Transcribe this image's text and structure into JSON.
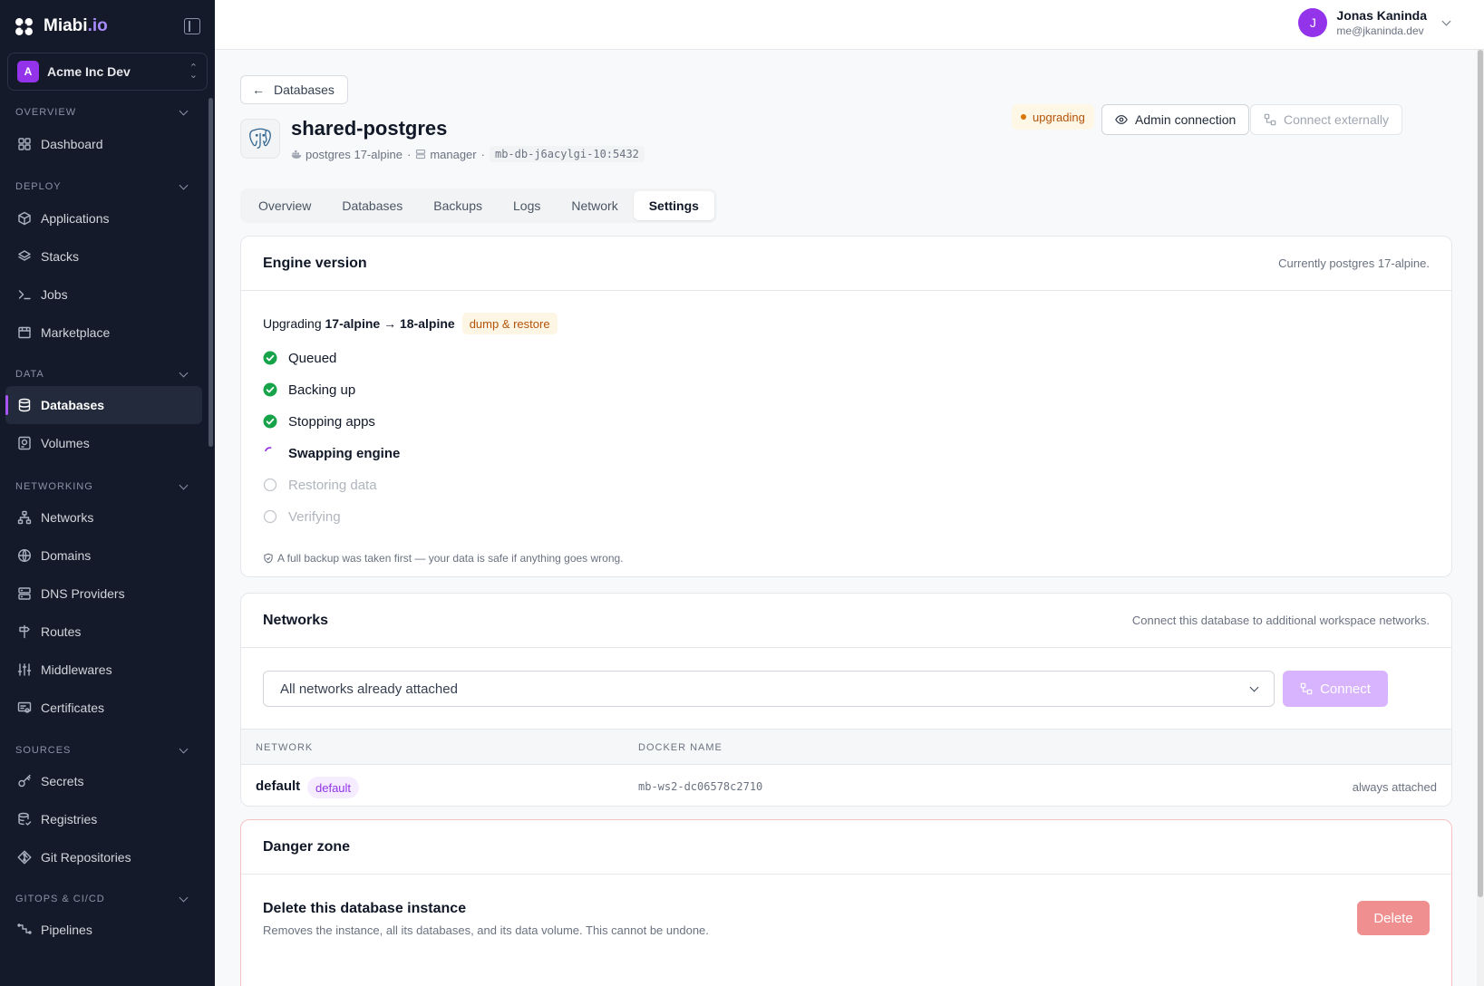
{
  "brand": {
    "name": "Miabi",
    "tld": ".io"
  },
  "workspace": {
    "initial": "A",
    "name": "Acme Inc Dev"
  },
  "sidebar": {
    "sections": [
      {
        "title": "OVERVIEW",
        "items": [
          {
            "label": "Dashboard",
            "icon": "dashboard-icon"
          }
        ]
      },
      {
        "title": "DEPLOY",
        "items": [
          {
            "label": "Applications",
            "icon": "cube-icon"
          },
          {
            "label": "Stacks",
            "icon": "layers-icon"
          },
          {
            "label": "Jobs",
            "icon": "terminal-icon"
          },
          {
            "label": "Marketplace",
            "icon": "store-icon"
          }
        ]
      },
      {
        "title": "DATA",
        "items": [
          {
            "label": "Databases",
            "icon": "database-icon",
            "active": true
          },
          {
            "label": "Volumes",
            "icon": "hard-drive-icon"
          }
        ]
      },
      {
        "title": "NETWORKING",
        "items": [
          {
            "label": "Networks",
            "icon": "network-icon"
          },
          {
            "label": "Domains",
            "icon": "globe-icon"
          },
          {
            "label": "DNS Providers",
            "icon": "server-icon"
          },
          {
            "label": "Routes",
            "icon": "signpost-icon"
          },
          {
            "label": "Middlewares",
            "icon": "sliders-icon"
          },
          {
            "label": "Certificates",
            "icon": "certificate-icon"
          }
        ]
      },
      {
        "title": "SOURCES",
        "items": [
          {
            "label": "Secrets",
            "icon": "key-icon"
          },
          {
            "label": "Registries",
            "icon": "registry-icon"
          },
          {
            "label": "Git Repositories",
            "icon": "git-icon"
          }
        ]
      },
      {
        "title": "GITOPS & CI/CD",
        "items": [
          {
            "label": "Pipelines",
            "icon": "pipeline-icon"
          }
        ]
      }
    ]
  },
  "user": {
    "initial": "J",
    "name": "Jonas Kaninda",
    "email": "me@jkaninda.dev"
  },
  "header": {
    "back_label": "Databases",
    "title": "shared-postgres",
    "engine": "postgres 17-alpine",
    "node": "manager",
    "host": "mb-db-j6acylgi-10:5432",
    "status": "upgrading",
    "admin_connection": "Admin connection",
    "connect_externally": "Connect externally"
  },
  "tabs": [
    {
      "label": "Overview"
    },
    {
      "label": "Databases"
    },
    {
      "label": "Backups"
    },
    {
      "label": "Logs"
    },
    {
      "label": "Network"
    },
    {
      "label": "Settings",
      "active": true
    }
  ],
  "engine_card": {
    "title": "Engine version",
    "subtitle": "Currently postgres 17-alpine.",
    "upgrading_prefix": "Upgrading",
    "from": "17-alpine",
    "arrow": "→",
    "to": "18-alpine",
    "method": "dump & restore",
    "steps": [
      {
        "label": "Queued",
        "state": "done"
      },
      {
        "label": "Backing up",
        "state": "done"
      },
      {
        "label": "Stopping apps",
        "state": "done"
      },
      {
        "label": "Swapping engine",
        "state": "active"
      },
      {
        "label": "Restoring data",
        "state": "pending"
      },
      {
        "label": "Verifying",
        "state": "pending"
      }
    ],
    "note": "A full backup was taken first — your data is safe if anything goes wrong."
  },
  "networks_card": {
    "title": "Networks",
    "subtitle": "Connect this database to additional workspace networks.",
    "select_value": "All networks already attached",
    "connect_label": "Connect",
    "columns": {
      "network": "NETWORK",
      "docker_name": "DOCKER NAME"
    },
    "rows": [
      {
        "network": "default",
        "badge": "default",
        "docker_name": "mb-ws2-dc06578c2710",
        "status": "always attached"
      }
    ]
  },
  "danger_card": {
    "title": "Danger zone",
    "action_title": "Delete this database instance",
    "action_desc": "Removes the instance, all its databases, and its data volume. This cannot be undone.",
    "delete_label": "Delete"
  },
  "colors": {
    "accent": "#9333ea",
    "sidebar_bg": "#141a29",
    "success": "#16a34a",
    "warning": "#d97706",
    "danger": "#f08f8f"
  }
}
